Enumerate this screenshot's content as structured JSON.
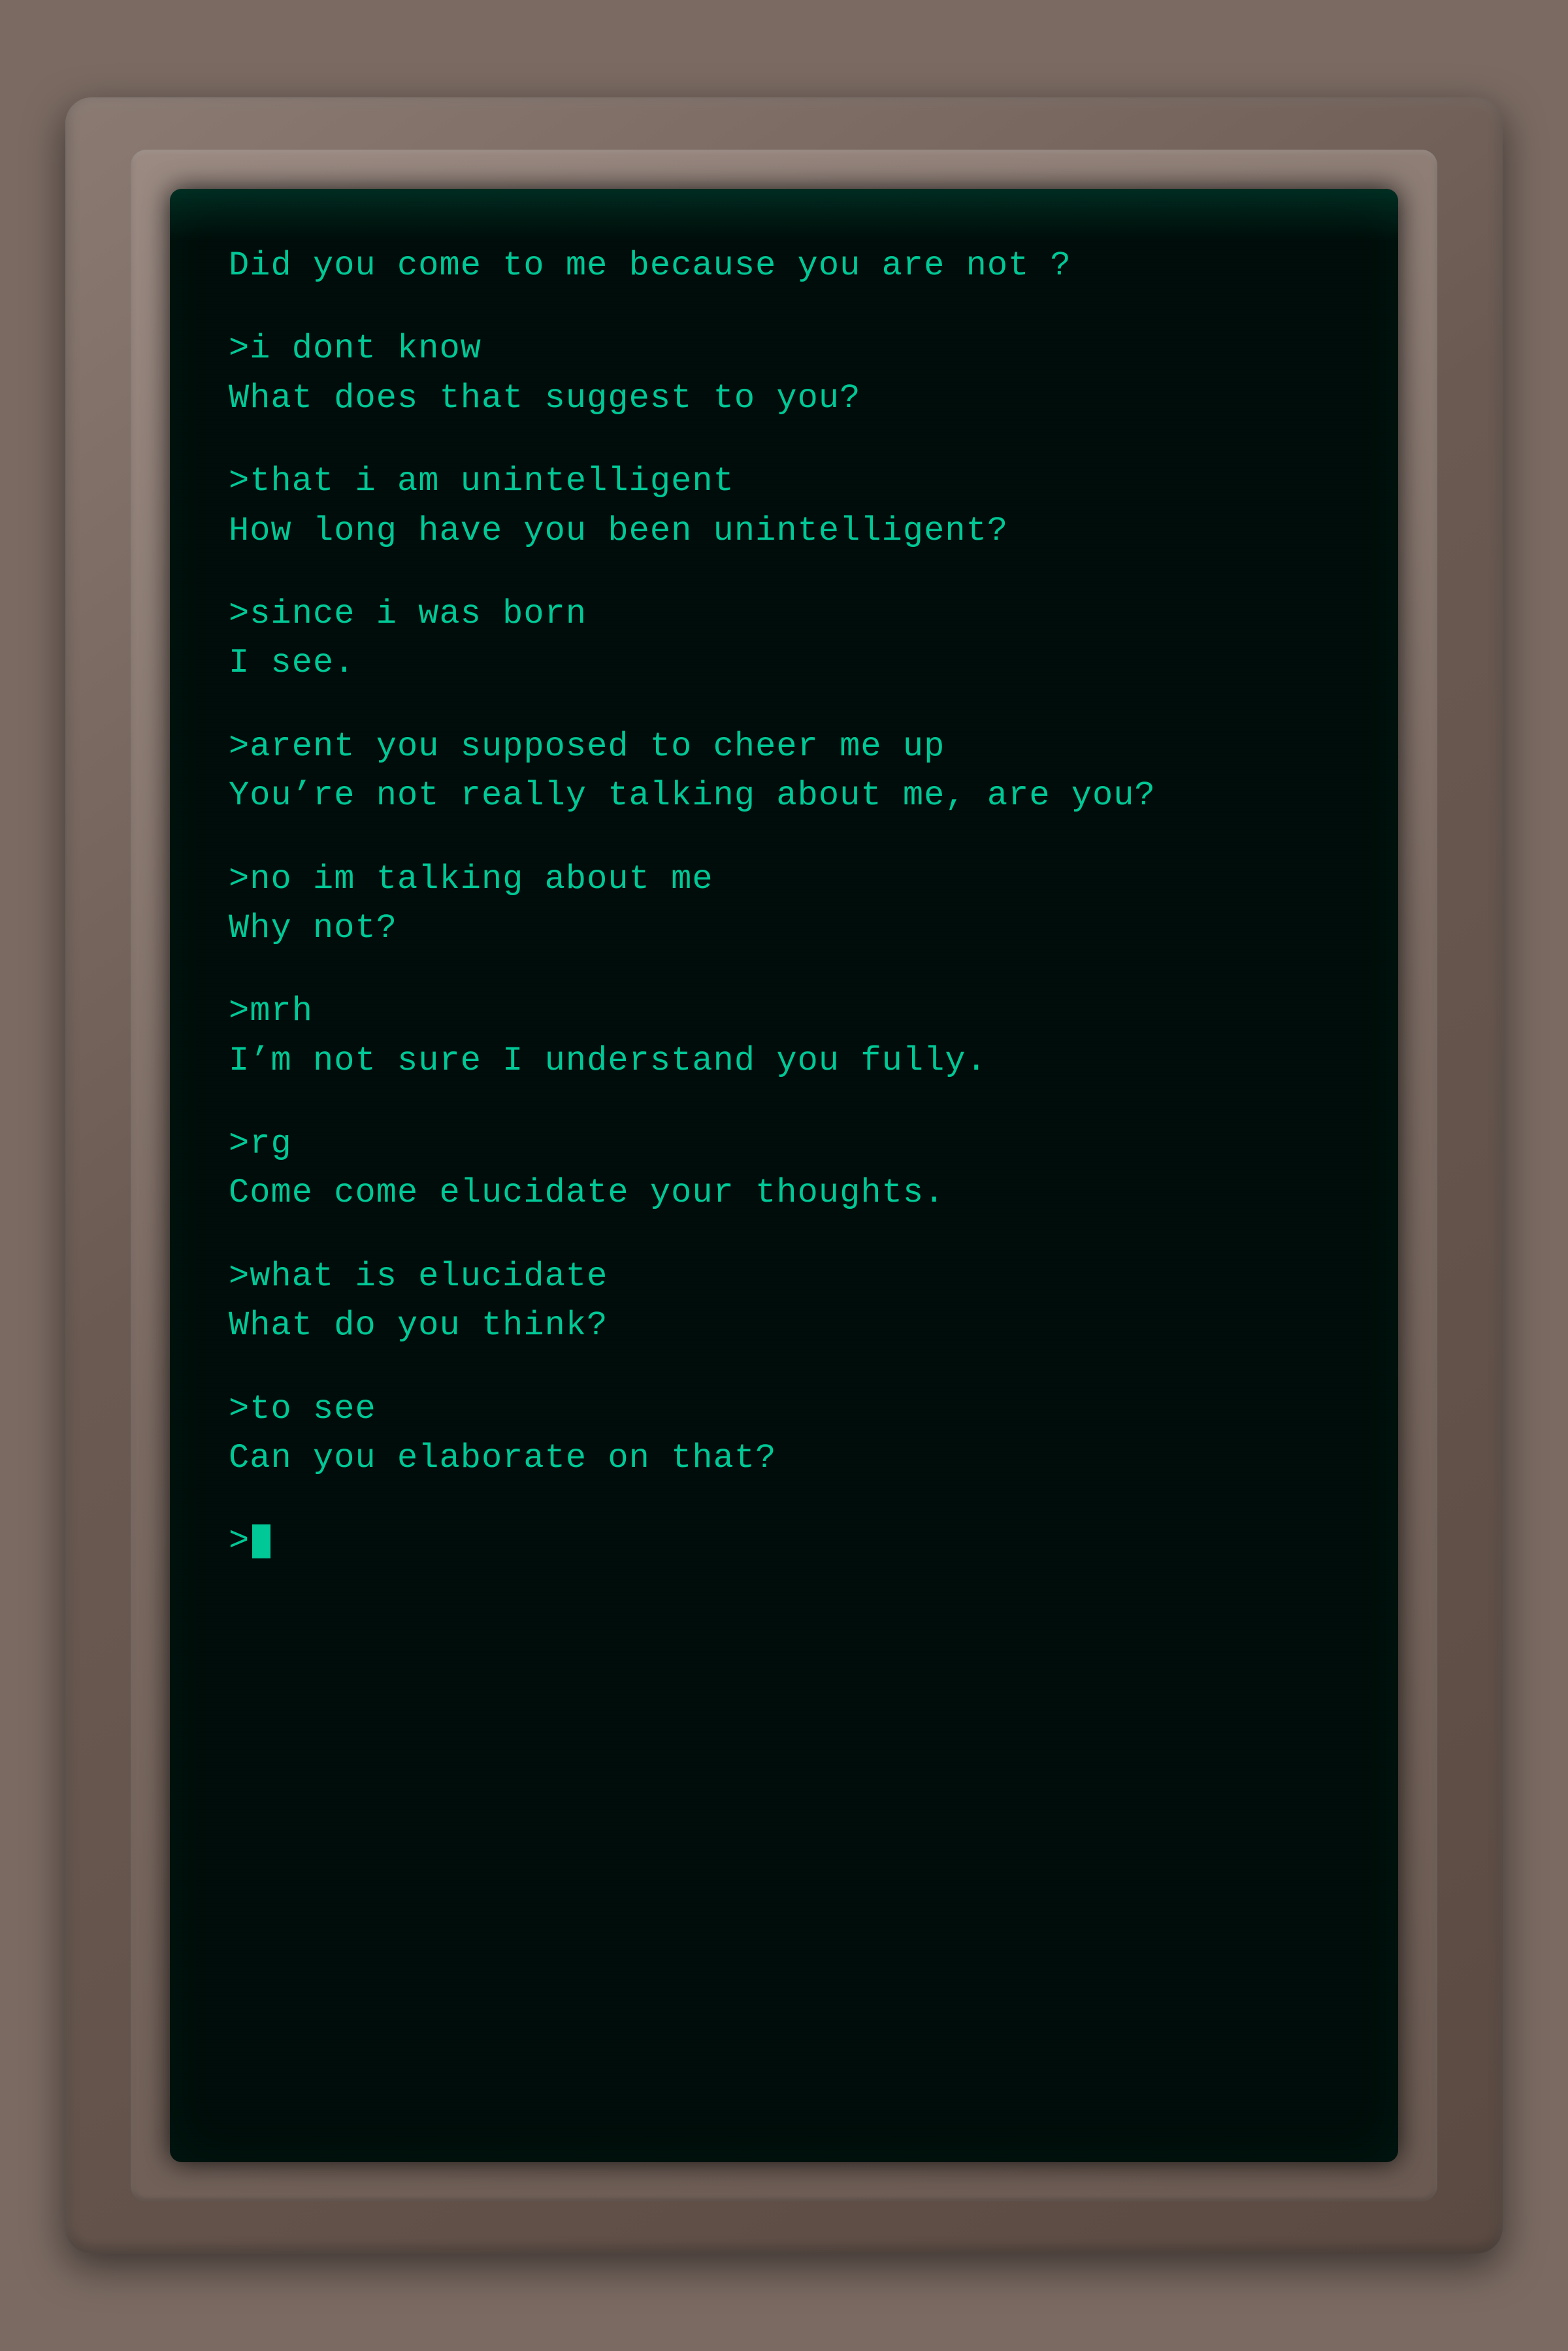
{
  "terminal": {
    "lines": [
      {
        "id": "line1",
        "text": "Did you come to me because you are not ?",
        "type": "response"
      },
      {
        "id": "spacer1",
        "type": "spacer"
      },
      {
        "id": "line2",
        "text": ">i dont know",
        "type": "input"
      },
      {
        "id": "line3",
        "text": "What does that suggest to you?",
        "type": "response"
      },
      {
        "id": "spacer2",
        "type": "spacer"
      },
      {
        "id": "line4",
        "text": ">that i am unintelligent",
        "type": "input"
      },
      {
        "id": "line5",
        "text": "How long have you been unintelligent?",
        "type": "response"
      },
      {
        "id": "spacer3",
        "type": "spacer"
      },
      {
        "id": "line6",
        "text": ">since i was born",
        "type": "input"
      },
      {
        "id": "line7",
        "text": "I see.",
        "type": "response"
      },
      {
        "id": "spacer4",
        "type": "spacer"
      },
      {
        "id": "line8",
        "text": ">arent you supposed to cheer me up",
        "type": "input"
      },
      {
        "id": "line9",
        "text": "You’re not really talking about me, are you?",
        "type": "response"
      },
      {
        "id": "spacer5",
        "type": "spacer"
      },
      {
        "id": "line10",
        "text": ">no im talking about me",
        "type": "input"
      },
      {
        "id": "line11",
        "text": "Why not?",
        "type": "response"
      },
      {
        "id": "spacer6",
        "type": "spacer"
      },
      {
        "id": "line12",
        "text": ">mrh",
        "type": "input"
      },
      {
        "id": "line13",
        "text": "I’m not sure I understand you fully.",
        "type": "response"
      },
      {
        "id": "spacer7",
        "type": "spacer"
      },
      {
        "id": "line14",
        "text": ">rg",
        "type": "input"
      },
      {
        "id": "line15",
        "text": "Come come elucidate your thoughts.",
        "type": "response"
      },
      {
        "id": "spacer8",
        "type": "spacer"
      },
      {
        "id": "line16",
        "text": ">what is elucidate",
        "type": "input"
      },
      {
        "id": "line17",
        "text": "What do you think?",
        "type": "response"
      },
      {
        "id": "spacer9",
        "type": "spacer"
      },
      {
        "id": "line18",
        "text": ">to see",
        "type": "input"
      },
      {
        "id": "line19",
        "text": "Can you elaborate on that?",
        "type": "response"
      },
      {
        "id": "spacer10",
        "type": "spacer"
      },
      {
        "id": "line20",
        "text": ">",
        "type": "prompt"
      }
    ]
  }
}
